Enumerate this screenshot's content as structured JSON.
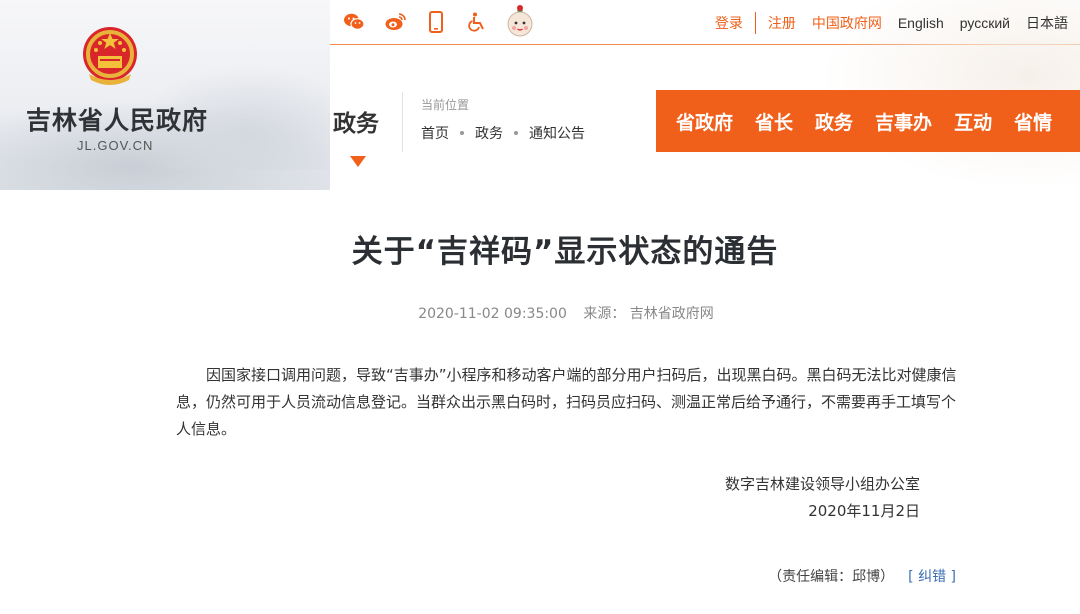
{
  "site": {
    "name": "吉林省人民政府",
    "domain": "JL.GOV.CN"
  },
  "topbar": {
    "icons": [
      "wechat-icon",
      "weibo-icon",
      "mobile-icon",
      "accessibility-icon",
      "mascot-icon"
    ],
    "links": {
      "login": "登录",
      "register": "注册",
      "gov_portal": "中国政府网",
      "english": "English",
      "russian": "русский",
      "japanese": "日本語"
    }
  },
  "section": {
    "title": "政务",
    "location_label": "当前位置",
    "breadcrumb": [
      "首页",
      "政务",
      "通知公告"
    ]
  },
  "main_nav": [
    "省政府",
    "省长",
    "政务",
    "吉事办",
    "互动",
    "省情"
  ],
  "article": {
    "title": "关于“吉祥码”显示状态的通告",
    "datetime": "2020-11-02 09:35:00",
    "source": "来源： 吉林省政府网",
    "body": "因国家接口调用问题，导致“吉事办”小程序和移动客户端的部分用户扫码后，出现黑白码。黑白码无法比对健康信息，仍然可用于人员流动信息登记。当群众出示黑白码时，扫码员应扫码、测温正常后给予通行，不需要再手工填写个人信息。",
    "signer": "数字吉林建设领导小组办公室",
    "sign_date": "2020年11月2日",
    "editor": "（责任编辑：邱博）",
    "report_error": "[ 纠错 ]"
  },
  "colors": {
    "accent": "#f0601b",
    "link_blue": "#3a6eb5"
  }
}
